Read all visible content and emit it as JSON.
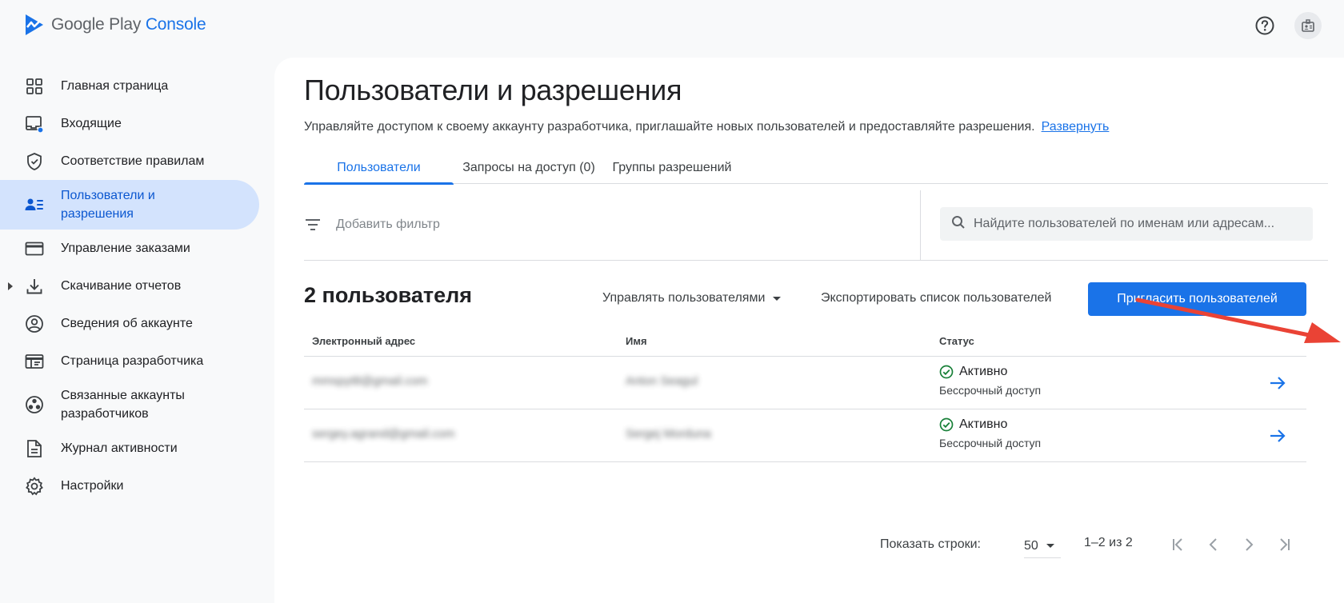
{
  "header": {
    "logo_google_play": "Google Play",
    "logo_console": "Console",
    "help_icon": "help-circle-icon",
    "account_icon": "account-badge-icon"
  },
  "sidebar": {
    "items": [
      {
        "label": "Главная страница",
        "icon": "dashboard-icon"
      },
      {
        "label": "Входящие",
        "icon": "inbox-icon"
      },
      {
        "label": "Соответствие правилам",
        "icon": "shield-icon"
      },
      {
        "label": "Пользователи и разрешения",
        "icon": "users-permissions-icon",
        "active": true
      },
      {
        "label": "Управление заказами",
        "icon": "credit-card-icon"
      },
      {
        "label": "Скачивание отчетов",
        "icon": "download-icon"
      },
      {
        "label": "Сведения об аккаунте",
        "icon": "account-circle-icon"
      },
      {
        "label": "Страница разработчика",
        "icon": "web-page-icon"
      },
      {
        "label": "Связанные аккаунты разработчиков",
        "icon": "linked-accounts-icon"
      },
      {
        "label": "Журнал активности",
        "icon": "document-icon"
      },
      {
        "label": "Настройки",
        "icon": "gear-icon"
      }
    ]
  },
  "main": {
    "title": "Пользователи и разрешения",
    "description": "Управляйте доступом к своему аккаунту разработчика, приглашайте новых пользователей и предоставляйте разрешения.",
    "expand_link": "Развернуть",
    "tabs": [
      {
        "label": "Пользователи",
        "active": true
      },
      {
        "label": "Запросы на доступ (0)"
      },
      {
        "label": "Группы разрешений"
      }
    ],
    "filter_label": "Добавить фильтр",
    "search_placeholder": "Найдите пользователей по именам или адресам...",
    "count_title": "2 пользователя",
    "manage_users": "Управлять пользователями",
    "export_list": "Экспортировать список пользователей",
    "invite_users": "Пригласить пользователей",
    "table": {
      "columns": [
        "Электронный адрес",
        "Имя",
        "Статус"
      ],
      "rows": [
        {
          "email": "mmspyt8@gmail.com",
          "name": "Anton Seagul",
          "status": "Активно",
          "access": "Бессрочный доступ"
        },
        {
          "email": "sergey.agrand@gmail.com",
          "name": "Sergej Morduna",
          "status": "Активно",
          "access": "Бессрочный доступ"
        }
      ]
    },
    "pager": {
      "rows_label": "Показать строки:",
      "rows_value": "50",
      "range": "1–2 из 2"
    }
  },
  "colors": {
    "accent": "#1a73e8",
    "active_nav_bg": "#d3e3fd",
    "status_ok": "#188038",
    "annotation_arrow": "#ea4335"
  }
}
